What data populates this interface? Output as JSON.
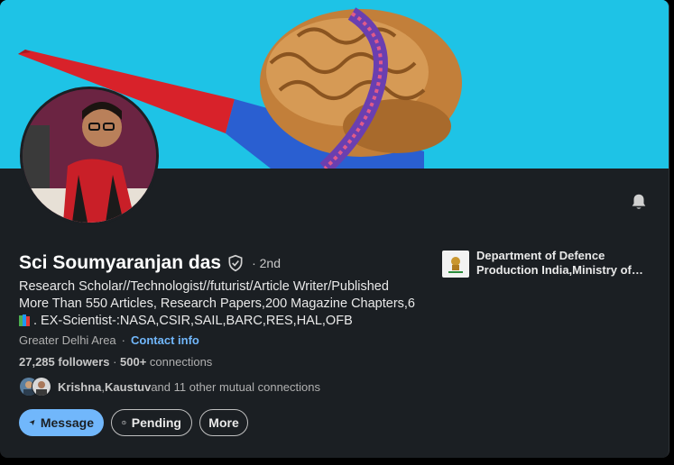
{
  "profile": {
    "name": "Sci Soumyaranjan das",
    "degree": "· 2nd",
    "headline_line1": "Research Scholar//Technologist//futurist/Article Writer/Published",
    "headline_line2": "More Than 550 Articles, Research Papers,200 Magazine Chapters,6",
    "headline_line3": ". EX-Scientist-:NASA,CSIR,SAIL,BARC,RES,HAL,OFB",
    "location": "Greater Delhi Area",
    "location_sep": "·",
    "contact_info": "Contact info",
    "followers": "27,285 followers",
    "followers_sep": " · ",
    "connections_count": "500+",
    "connections_label": " connections",
    "mutual_name1": "Krishna",
    "mutual_comma": ", ",
    "mutual_name2": "Kaustuv",
    "mutual_rest": " and 11 other mutual connections"
  },
  "organization": {
    "line1": "Department of Defence",
    "line2": "Production India,Ministry of ..."
  },
  "actions": {
    "message": "Message",
    "pending": "Pending",
    "more": "More"
  },
  "icons": {
    "verified": "shield-check-icon",
    "bell": "bell-icon",
    "message": "send-icon",
    "pending": "clock-icon"
  },
  "colors": {
    "background": "#1b1f23",
    "cover": "#1ec3e6",
    "accent": "#71b7fb",
    "text": "#e9e9e9",
    "muted": "#b0b0b0"
  }
}
